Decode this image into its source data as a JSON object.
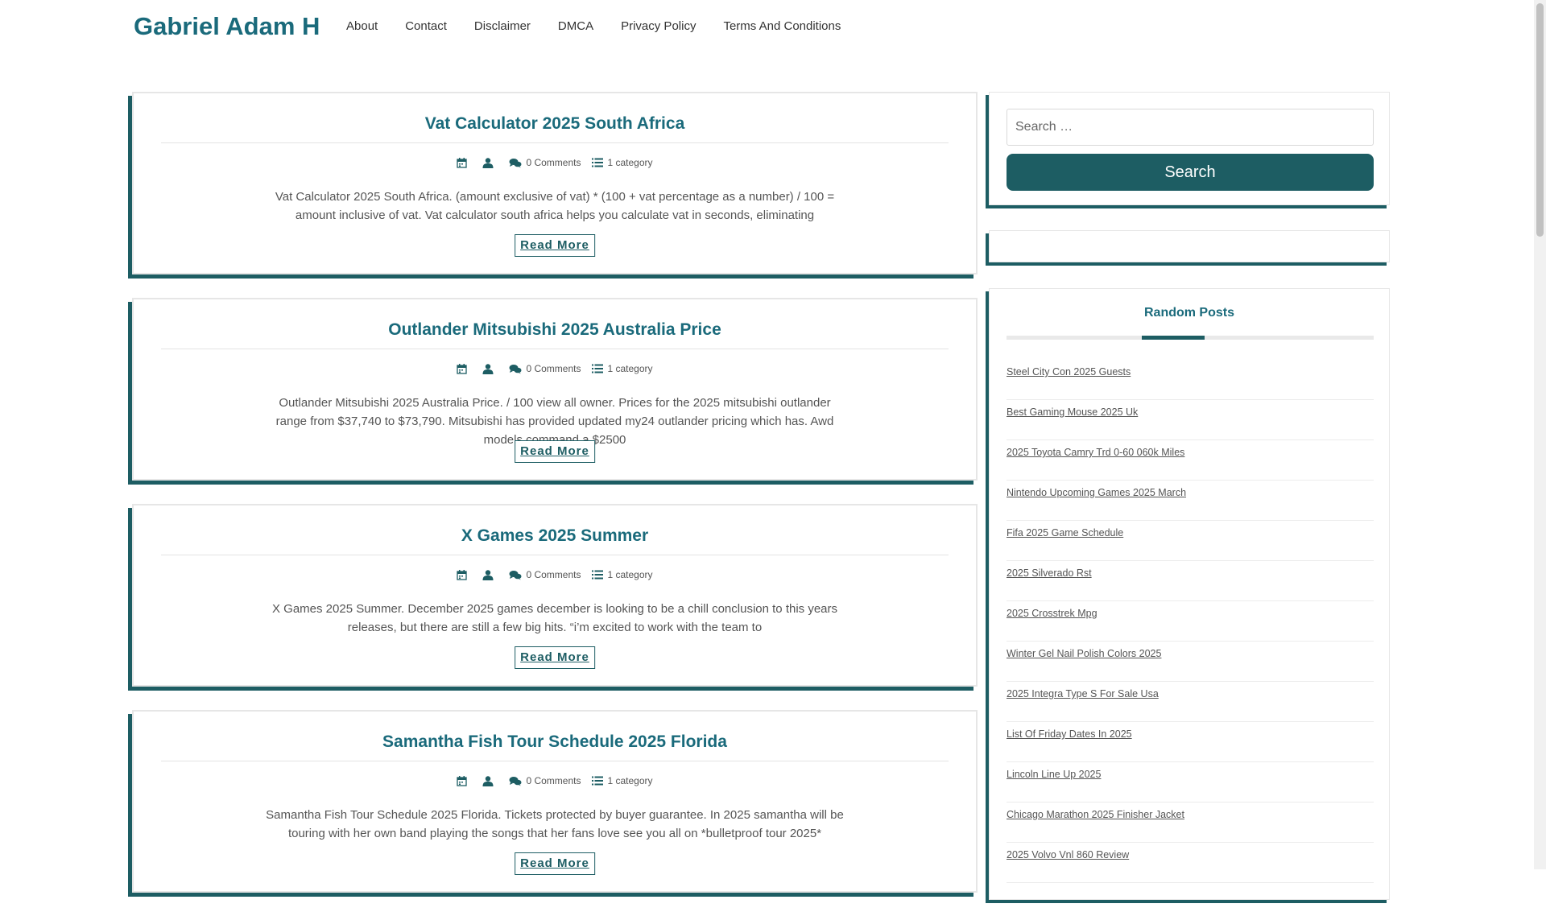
{
  "site": {
    "title": "Gabriel Adam H"
  },
  "nav": [
    {
      "label": "About"
    },
    {
      "label": "Contact"
    },
    {
      "label": "Disclaimer"
    },
    {
      "label": "DMCA"
    },
    {
      "label": "Privacy Policy"
    },
    {
      "label": "Terms And Conditions"
    }
  ],
  "posts": [
    {
      "title": "Vat Calculator 2025 South Africa",
      "comments": "0 Comments",
      "category": "1 category",
      "excerpt": "Vat Calculator 2025 South Africa. (amount exclusive of vat) * (100 + vat percentage as a number) / 100 = amount inclusive of vat. Vat calculator south africa helps you calculate vat in seconds, eliminating",
      "read_more": "Read More"
    },
    {
      "title": "Outlander Mitsubishi 2025 Australia Price",
      "comments": "0 Comments",
      "category": "1 category",
      "excerpt": "Outlander Mitsubishi 2025 Australia Price. / 100 view all owner. Prices for the 2025 mitsubishi outlander range from $37,740 to $73,790. Mitsubishi has provided updated my24 outlander pricing which has. Awd models command a $2500",
      "read_more": "Read More"
    },
    {
      "title": "X Games 2025 Summer",
      "comments": "0 Comments",
      "category": "1 category",
      "excerpt": "X Games 2025 Summer. December 2025 games december is looking to be a chill conclusion to this years releases, but there are still a few big hits. “i’m excited to work with the team to",
      "read_more": "Read More"
    },
    {
      "title": "Samantha Fish Tour Schedule 2025 Florida",
      "comments": "0 Comments",
      "category": "1 category",
      "excerpt": "Samantha Fish Tour Schedule 2025 Florida. Tickets protected by buyer guarantee. In 2025 samantha will be touring with her own band playing the songs that her fans love see you all on *bulletproof tour 2025*",
      "read_more": "Read More"
    }
  ],
  "search": {
    "placeholder": "Search …",
    "button_label": "Search"
  },
  "random_posts": {
    "title": "Random Posts",
    "items": [
      "Steel City Con 2025 Guests",
      "Best Gaming Mouse 2025 Uk",
      "2025 Toyota Camry Trd 0-60 060k Miles",
      "Nintendo Upcoming Games 2025 March",
      "Fifa 2025 Game Schedule",
      "2025 Silverado Rst",
      "2025 Crosstrek Mpg",
      "Winter Gel Nail Polish Colors 2025",
      "2025 Integra Type S For Sale Usa",
      "List Of Friday Dates In 2025",
      "Lincoln Line Up 2025",
      "Chicago Marathon 2025 Finisher Jacket",
      "2025 Volvo Vnl 860 Review"
    ]
  },
  "colors": {
    "accent": "#1a6a7b",
    "shadow": "#1d5d63"
  },
  "icons": {
    "date": "calendar-icon",
    "author": "user-icon",
    "comments": "comments-icon",
    "category": "list-icon"
  }
}
